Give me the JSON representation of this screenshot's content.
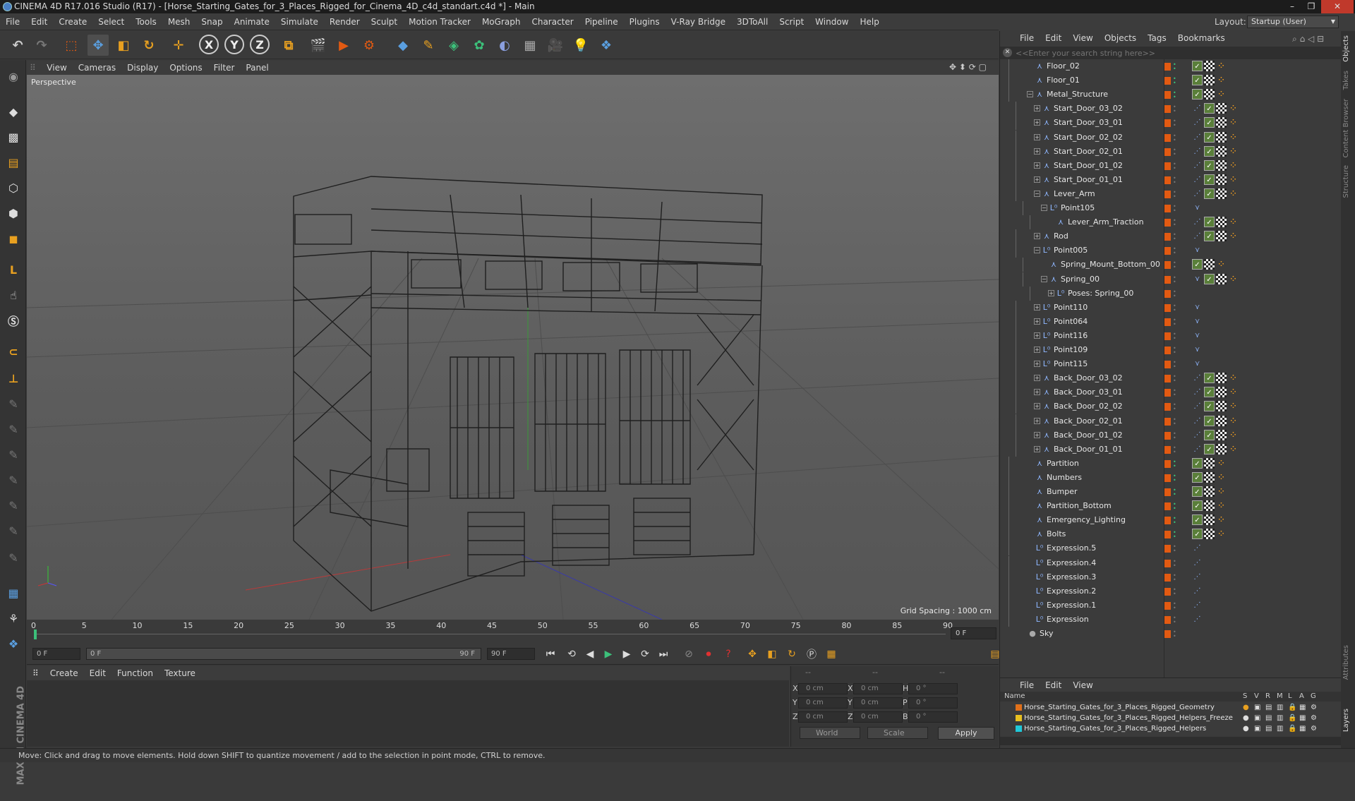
{
  "window": {
    "title": "CINEMA 4D R17.016 Studio (R17) - [Horse_Starting_Gates_for_3_Places_Rigged_for_Cinema_4D_c4d_standart.c4d *] - Main",
    "controls": [
      "–",
      "❐",
      "✕"
    ]
  },
  "menubar": [
    "File",
    "Edit",
    "Create",
    "Select",
    "Tools",
    "Mesh",
    "Snap",
    "Animate",
    "Simulate",
    "Render",
    "Sculpt",
    "Motion Tracker",
    "MoGraph",
    "Character",
    "Pipeline",
    "Plugins",
    "V-Ray Bridge",
    "3DToAll",
    "Script",
    "Window",
    "Help"
  ],
  "layout": {
    "label": "Layout:",
    "value": "Startup (User)"
  },
  "toolbar": {
    "axis_x": "X",
    "axis_y": "Y",
    "axis_z": "Z"
  },
  "viewport": {
    "menu": [
      "View",
      "Cameras",
      "Display",
      "Options",
      "Filter",
      "Panel"
    ],
    "label": "Perspective",
    "grid_spacing": "Grid Spacing : 1000 cm"
  },
  "timeline": {
    "ticks": [
      "0",
      "5",
      "10",
      "15",
      "20",
      "25",
      "30",
      "35",
      "40",
      "45",
      "50",
      "55",
      "60",
      "65",
      "70",
      "75",
      "80",
      "85",
      "90"
    ],
    "end_field": "0 F"
  },
  "playback": {
    "current": "0 F",
    "range_start": "0 F",
    "range_end": "90 F",
    "max": "90 F"
  },
  "material": {
    "menu": [
      "Create",
      "Edit",
      "Function",
      "Texture"
    ]
  },
  "coords": {
    "header": [
      "--",
      "--",
      "--"
    ],
    "rows": [
      {
        "a_label": "X",
        "a_val": "0 cm",
        "b_label": "X",
        "b_val": "0 cm",
        "c_label": "H",
        "c_val": "0 °"
      },
      {
        "a_label": "Y",
        "a_val": "0 cm",
        "b_label": "Y",
        "b_val": "0 cm",
        "c_label": "P",
        "c_val": "0 °"
      },
      {
        "a_label": "Z",
        "a_val": "0 cm",
        "b_label": "Z",
        "b_val": "0 cm",
        "c_label": "B",
        "c_val": "0 °"
      }
    ],
    "world": "World",
    "scale": "Scale",
    "apply": "Apply"
  },
  "objects": {
    "menu": [
      "File",
      "Edit",
      "View",
      "Objects",
      "Tags",
      "Bookmarks"
    ],
    "search_placeholder": "<<Enter your search string here>>",
    "items": [
      {
        "name": "Floor_02",
        "indent": 1,
        "icon": "bone",
        "tags": [
          "phong",
          "chk",
          "dots"
        ]
      },
      {
        "name": "Floor_01",
        "indent": 1,
        "icon": "bone",
        "tags": [
          "phong",
          "chk",
          "dots"
        ]
      },
      {
        "name": "Metal_Structure",
        "indent": 1,
        "icon": "bone",
        "exp": "−",
        "tags": [
          "phong",
          "chk",
          "dots"
        ]
      },
      {
        "name": "Start_Door_03_02",
        "indent": 2,
        "icon": "bone",
        "exp": "+",
        "tags": [
          "xp",
          "phong",
          "chk",
          "dots"
        ]
      },
      {
        "name": "Start_Door_03_01",
        "indent": 2,
        "icon": "bone",
        "exp": "+",
        "tags": [
          "xp",
          "phong",
          "chk",
          "dots"
        ]
      },
      {
        "name": "Start_Door_02_02",
        "indent": 2,
        "icon": "bone",
        "exp": "+",
        "tags": [
          "xp",
          "phong",
          "chk",
          "dots"
        ]
      },
      {
        "name": "Start_Door_02_01",
        "indent": 2,
        "icon": "bone",
        "exp": "+",
        "tags": [
          "xp",
          "phong",
          "chk",
          "dots"
        ]
      },
      {
        "name": "Start_Door_01_02",
        "indent": 2,
        "icon": "bone",
        "exp": "+",
        "tags": [
          "xp",
          "phong",
          "chk",
          "dots"
        ]
      },
      {
        "name": "Start_Door_01_01",
        "indent": 2,
        "icon": "bone",
        "exp": "+",
        "tags": [
          "xp",
          "phong",
          "chk",
          "dots"
        ]
      },
      {
        "name": "Lever_Arm",
        "indent": 2,
        "icon": "bone",
        "exp": "−",
        "tags": [
          "xp",
          "phong",
          "chk",
          "dots"
        ]
      },
      {
        "name": "Point105",
        "indent": 3,
        "icon": "null",
        "exp": "−",
        "tags": [
          "vx"
        ]
      },
      {
        "name": "Lever_Arm_Traction",
        "indent": 4,
        "icon": "bone",
        "tags": [
          "xp",
          "phong",
          "chk",
          "dots"
        ]
      },
      {
        "name": "Rod",
        "indent": 2,
        "icon": "bone",
        "exp": "+",
        "tags": [
          "xp",
          "phong",
          "chk",
          "dots"
        ]
      },
      {
        "name": "Point005",
        "indent": 2,
        "icon": "null",
        "exp": "−",
        "tags": [
          "vx"
        ]
      },
      {
        "name": "Spring_Mount_Bottom_00",
        "indent": 3,
        "icon": "bone",
        "tags": [
          "phong",
          "chk",
          "dots"
        ]
      },
      {
        "name": "Spring_00",
        "indent": 3,
        "icon": "bone",
        "exp": "−",
        "tags": [
          "vx",
          "phong",
          "chk",
          "dots"
        ]
      },
      {
        "name": "Poses: Spring_00",
        "indent": 4,
        "icon": "null",
        "exp": "+",
        "tags": []
      },
      {
        "name": "Point110",
        "indent": 2,
        "icon": "null",
        "exp": "+",
        "tags": [
          "vx"
        ]
      },
      {
        "name": "Point064",
        "indent": 2,
        "icon": "null",
        "exp": "+",
        "tags": [
          "vx"
        ]
      },
      {
        "name": "Point116",
        "indent": 2,
        "icon": "null",
        "exp": "+",
        "tags": [
          "vx"
        ]
      },
      {
        "name": "Point109",
        "indent": 2,
        "icon": "null",
        "exp": "+",
        "tags": [
          "vx"
        ]
      },
      {
        "name": "Point115",
        "indent": 2,
        "icon": "null",
        "exp": "+",
        "tags": [
          "vx"
        ]
      },
      {
        "name": "Back_Door_03_02",
        "indent": 2,
        "icon": "bone",
        "exp": "+",
        "tags": [
          "xp",
          "phong",
          "chk",
          "dots"
        ]
      },
      {
        "name": "Back_Door_03_01",
        "indent": 2,
        "icon": "bone",
        "exp": "+",
        "tags": [
          "xp",
          "phong",
          "chk",
          "dots"
        ]
      },
      {
        "name": "Back_Door_02_02",
        "indent": 2,
        "icon": "bone",
        "exp": "+",
        "tags": [
          "xp",
          "phong",
          "chk",
          "dots"
        ]
      },
      {
        "name": "Back_Door_02_01",
        "indent": 2,
        "icon": "bone",
        "exp": "+",
        "tags": [
          "xp",
          "phong",
          "chk",
          "dots"
        ]
      },
      {
        "name": "Back_Door_01_02",
        "indent": 2,
        "icon": "bone",
        "exp": "+",
        "tags": [
          "xp",
          "phong",
          "chk",
          "dots"
        ]
      },
      {
        "name": "Back_Door_01_01",
        "indent": 2,
        "icon": "bone",
        "exp": "+",
        "tags": [
          "xp",
          "phong",
          "chk",
          "dots"
        ]
      },
      {
        "name": "Partition",
        "indent": 1,
        "icon": "bone",
        "tags": [
          "phong",
          "chk",
          "dots"
        ]
      },
      {
        "name": "Numbers",
        "indent": 1,
        "icon": "bone",
        "tags": [
          "phong",
          "chk",
          "dots"
        ]
      },
      {
        "name": "Bumper",
        "indent": 1,
        "icon": "bone",
        "tags": [
          "phong",
          "chk",
          "dots"
        ]
      },
      {
        "name": "Partition_Bottom",
        "indent": 1,
        "icon": "bone",
        "tags": [
          "phong",
          "chk",
          "dots"
        ]
      },
      {
        "name": "Emergency_Lighting",
        "indent": 1,
        "icon": "bone",
        "tags": [
          "phong",
          "chk",
          "dots"
        ]
      },
      {
        "name": "Bolts",
        "indent": 1,
        "icon": "bone",
        "tags": [
          "phong",
          "chk",
          "dots"
        ]
      },
      {
        "name": "Expression.5",
        "indent": 1,
        "icon": "null",
        "tags": [
          "xp"
        ]
      },
      {
        "name": "Expression.4",
        "indent": 1,
        "icon": "null",
        "tags": [
          "xp"
        ]
      },
      {
        "name": "Expression.3",
        "indent": 1,
        "icon": "null",
        "tags": [
          "xp"
        ]
      },
      {
        "name": "Expression.2",
        "indent": 1,
        "icon": "null",
        "tags": [
          "xp"
        ]
      },
      {
        "name": "Expression.1",
        "indent": 1,
        "icon": "null",
        "tags": [
          "xp"
        ]
      },
      {
        "name": "Expression",
        "indent": 1,
        "icon": "null",
        "tags": [
          "xp"
        ]
      },
      {
        "name": "Sky",
        "indent": 0,
        "icon": "sky",
        "tags": []
      }
    ]
  },
  "layers": {
    "menu": [
      "File",
      "Edit",
      "View"
    ],
    "header": {
      "name": "Name",
      "cols": [
        "S",
        "V",
        "R",
        "M",
        "L",
        "A",
        "G"
      ]
    },
    "items": [
      {
        "name": "Horse_Starting_Gates_for_3_Places_Rigged_Geometry",
        "color": "#e0701a"
      },
      {
        "name": "Horse_Starting_Gates_for_3_Places_Rigged_Helpers_Freeze",
        "color": "#e8c020"
      },
      {
        "name": "Horse_Starting_Gates_for_3_Places_Rigged_Helpers",
        "color": "#20c8d8"
      }
    ]
  },
  "side_tabs": [
    "Objects",
    "Takes",
    "Content Browser",
    "Structure",
    "Attributes",
    "Layers"
  ],
  "status": "Move: Click and drag to move elements. Hold down SHIFT to quantize movement / add to the selection in point mode, CTRL to remove.",
  "colors": {
    "accent": "#e25a12",
    "selection": "#5a7fbf"
  }
}
